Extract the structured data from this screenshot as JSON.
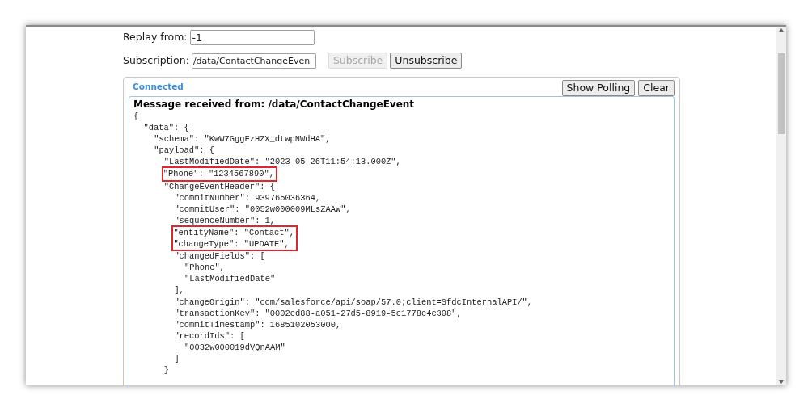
{
  "form": {
    "replay": {
      "label": "Replay from:",
      "value": "-1"
    },
    "subscription": {
      "label": "Subscription:",
      "value": "/data/ContactChangeEven"
    },
    "buttons": [
      {
        "label": "Subscribe",
        "disabled": true
      },
      {
        "label": "Unsubscribe",
        "disabled": false
      }
    ]
  },
  "panel": {
    "status": "Connected",
    "buttons": [
      "Show Polling",
      "Clear"
    ],
    "message": {
      "heading": "Message received from: /data/ContactChangeEvent",
      "lines": [
        {
          "text": "{",
          "highlighted": false,
          "children": [
            {
              "text": "\"data\": {",
              "highlighted": false,
              "children": [
                {
                  "text": "\"schema\": \"KwW7GggFzHZX_dtwpNWdHA\",",
                  "highlighted": false
                },
                {
                  "text": "\"payload\": {",
                  "highlighted": false,
                  "children": [
                    {
                      "text": "\"LastModifiedDate\": \"2023-05-26T11:54:13.000Z\",",
                      "highlighted": false
                    },
                    {
                      "text": "\"Phone\": \"1234567890\",",
                      "highlighted": true
                    },
                    {
                      "text": "\"ChangeEventHeader\": {",
                      "highlighted": false,
                      "close": "}",
                      "children": [
                        {
                          "text": "\"commitNumber\": 939765036364,",
                          "highlighted": false
                        },
                        {
                          "text": "\"commitUser\": \"0052w000009MLsZAAW\",",
                          "highlighted": false
                        },
                        {
                          "text": "\"sequenceNumber\": 1,",
                          "highlighted": false
                        },
                        {
                          "text": "\"entityName\": \"Contact\",",
                          "highlighted": true
                        },
                        {
                          "text": "\"changeType\": \"UPDATE\",",
                          "highlighted": true
                        },
                        {
                          "text": "\"changedFields\": [",
                          "highlighted": false,
                          "close": "],",
                          "children": [
                            {
                              "text": "\"Phone\",",
                              "highlighted": false
                            },
                            {
                              "text": "\"LastModifiedDate\"",
                              "highlighted": false
                            }
                          ]
                        },
                        {
                          "text": "\"changeOrigin\": \"com/salesforce/api/soap/57.0;client=SfdcInternalAPI/\",",
                          "highlighted": false
                        },
                        {
                          "text": "\"transactionKey\": \"0002ed88-a051-27d5-8919-5e1778e4c308\",",
                          "highlighted": false
                        },
                        {
                          "text": "\"commitTimestamp\": 1685102053000,",
                          "highlighted": false
                        },
                        {
                          "text": "\"recordIds\": [",
                          "highlighted": false,
                          "close": "]",
                          "children": [
                            {
                              "text": "\"0032w000019dVQnAAM\"",
                              "highlighted": false
                            }
                          ]
                        }
                      ]
                    }
                  ]
                }
              ]
            }
          ]
        }
      ]
    }
  }
}
